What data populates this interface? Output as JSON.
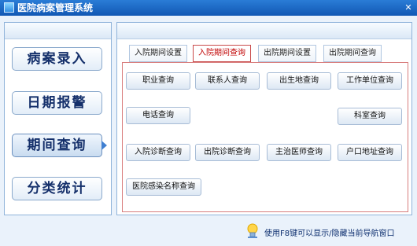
{
  "window": {
    "title": "医院病案管理系统",
    "close_symbol": "✕"
  },
  "nav": {
    "items": [
      {
        "label": "病案录入",
        "name": "nav-case-entry"
      },
      {
        "label": "日期报警",
        "name": "nav-date-alert"
      },
      {
        "label": "期间查询",
        "name": "nav-period-query",
        "active": true
      },
      {
        "label": "分类统计",
        "name": "nav-category-stats"
      }
    ]
  },
  "tabs": [
    {
      "label": "入院期间设置",
      "active": false
    },
    {
      "label": "入院期间查询",
      "active": true
    },
    {
      "label": "出院期间设置",
      "active": false
    },
    {
      "label": "出院期间查询",
      "active": false
    }
  ],
  "query_buttons": [
    "职业查询",
    "联系人查询",
    "出生地查询",
    "工作单位查询",
    "电话查询",
    "科室查询",
    "入院诊断查询",
    "出院诊断查询",
    "主治医师查询",
    "户口地址查询",
    "医院感染名称查询"
  ],
  "status": {
    "hint": "使用F8键可以显示/隐藏当前导航窗口"
  },
  "colors": {
    "title_bar": "#1a68c4",
    "active_tab_text": "#c00000",
    "nav_text": "#15306b"
  }
}
